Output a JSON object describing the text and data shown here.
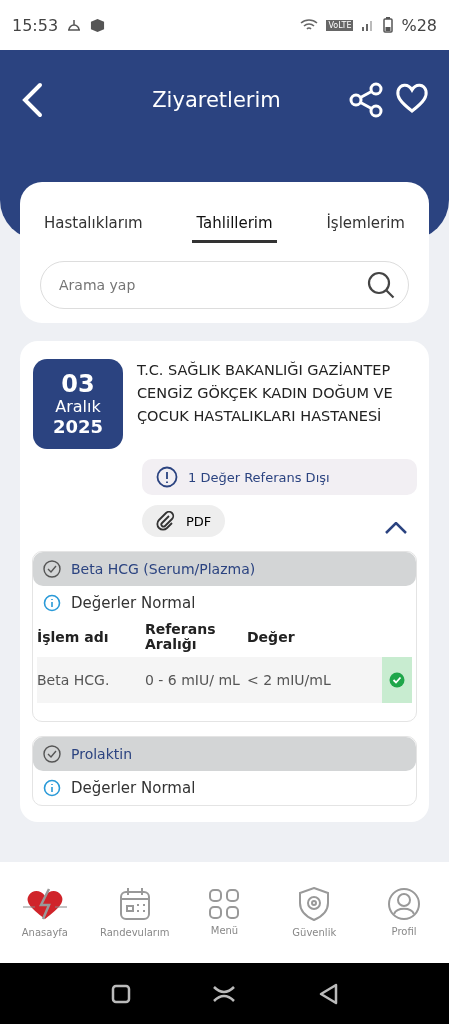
{
  "status_bar": {
    "time": "15:53",
    "network": "VoLTE",
    "battery": "%28"
  },
  "header": {
    "title": "Ziyaretlerim"
  },
  "tabs": [
    {
      "label": "Hastalıklarım",
      "selected": false
    },
    {
      "label": "Tahlillerim",
      "selected": true
    },
    {
      "label": "İşlemlerim",
      "selected": false
    }
  ],
  "search": {
    "placeholder": "Arama yap"
  },
  "visit": {
    "day": "03",
    "month": "Aralık",
    "year": "2025",
    "hospital": "T.C. SAĞLIK BAKANLIĞI GAZİANTEP CENGİZ GÖKÇEK KADIN DOĞUM VE ÇOCUK HASTALIKLARI HASTANESİ",
    "alert": "1 Değer Referans Dışı",
    "attachment": "PDF",
    "expanded": true,
    "tests": [
      {
        "name": "Beta HCG (Serum/Plazma)",
        "status": "Değerler Normal",
        "columns": [
          "İşlem adı",
          "Referans Aralığı",
          "Değer"
        ],
        "rows": [
          {
            "name": "Beta HCG.",
            "range": "0 - 6 mIU/ mL",
            "value": "< 2 mIU/mL",
            "in_range": true
          }
        ]
      },
      {
        "name": "Prolaktin",
        "status": "Değerler Normal"
      }
    ]
  },
  "bottom_nav": [
    {
      "label": "Anasayfa",
      "kind": "home",
      "selected": true
    },
    {
      "label": "Randevularım",
      "kind": "calendar",
      "selected": false
    },
    {
      "label": "Menü",
      "kind": "grid",
      "selected": false
    },
    {
      "label": "Güvenlik",
      "kind": "shield",
      "selected": false
    },
    {
      "label": "Profil",
      "kind": "profile",
      "selected": false
    }
  ]
}
